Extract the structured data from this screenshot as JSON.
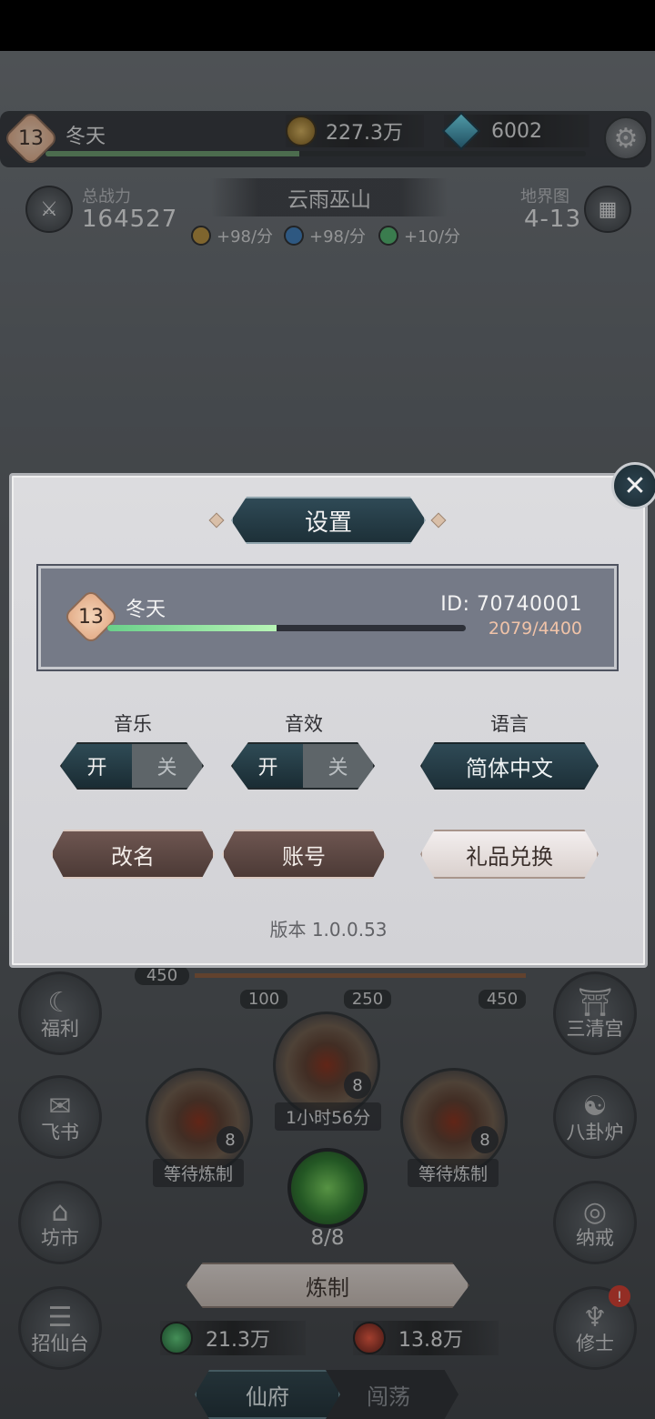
{
  "player": {
    "level": "13",
    "name": "冬天",
    "exp_fraction": 0.47
  },
  "currency": {
    "coins": "227.3万",
    "gems": "6002"
  },
  "stats": {
    "power_label": "总战力",
    "power_value": "164527",
    "location": "云雨巫山",
    "map_label": "地界图",
    "map_value": "4-13",
    "rates": [
      "+98/分",
      "+98/分",
      "+10/分"
    ]
  },
  "scene": {
    "progress_marks": [
      "450",
      "100",
      "250",
      "450"
    ],
    "left_buttons": [
      "福利",
      "飞书",
      "坊市",
      "招仙台"
    ],
    "right_buttons": [
      "三清宫",
      "八卦炉",
      "纳戒",
      "修士"
    ],
    "furnaces": [
      {
        "count": "8",
        "label": "等待炼制"
      },
      {
        "count": "8",
        "label": "1小时56分"
      },
      {
        "count": "8",
        "label": "等待炼制"
      }
    ],
    "jade_count": "8/8",
    "craft_label": "炼制",
    "resources": [
      "21.3万",
      "13.8万"
    ],
    "tabs": [
      "仙府",
      "闯荡"
    ]
  },
  "settings": {
    "title": "设置",
    "close_icon": "✕",
    "profile": {
      "level": "13",
      "name": "冬天",
      "id": "ID: 70740001",
      "exp_text": "2079/4400",
      "exp_fraction": 0.4725
    },
    "music_label": "音乐",
    "sound_label": "音效",
    "language_label": "语言",
    "on_label": "开",
    "off_label": "关",
    "language_value": "简体中文",
    "rename_label": "改名",
    "account_label": "账号",
    "gift_label": "礼品兑换",
    "version": "版本 1.0.0.53"
  }
}
